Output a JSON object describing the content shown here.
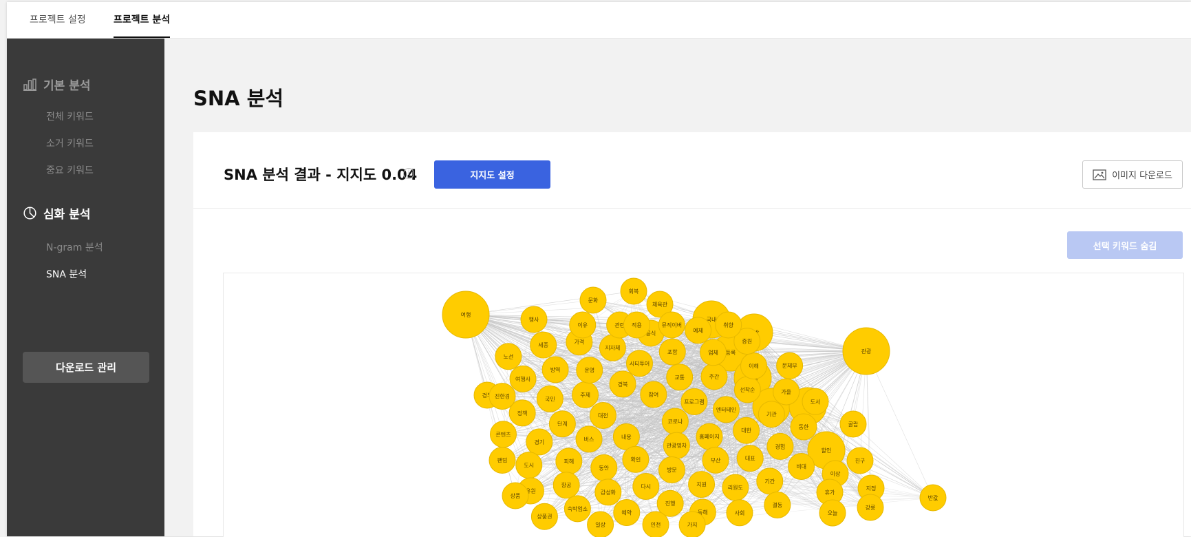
{
  "tabs": [
    {
      "label": "프로젝트 설정"
    },
    {
      "label": "프로젝트 분석"
    }
  ],
  "sidebar": {
    "basic": {
      "label": "기본 분석",
      "items": [
        {
          "label": "전체 키워드"
        },
        {
          "label": "소거 키워드"
        },
        {
          "label": "중요 키워드"
        }
      ]
    },
    "deep": {
      "label": "심화 분석",
      "items": [
        {
          "label": "N-gram 분석"
        },
        {
          "label": "SNA 분석"
        }
      ]
    },
    "download_label": "다운로드 관리"
  },
  "page_title": "SNA 분석",
  "panel": {
    "result_title": "SNA 분석 결과 - 지지도 0.04",
    "info_icon": "i",
    "support_button": "지지도 설정",
    "image_download": "이미지 다운로드",
    "hide_selected": "선택 키워드 숨김"
  },
  "colors": {
    "node": "#ffcc00",
    "node_stroke": "#e6b800",
    "edge": "#c4c4c4",
    "primary": "#3a63e0",
    "primary_disabled": "#b9c8f3",
    "sidebar": "#3a3a3a"
  },
  "network": {
    "nodes": [
      {
        "label": "여행",
        "size": "xl"
      },
      {
        "label": "관광",
        "size": "xl"
      },
      {
        "label": "국내",
        "size": "l"
      },
      {
        "label": "숙박",
        "size": "l"
      },
      {
        "label": "문화",
        "size": "m"
      },
      {
        "label": "회복",
        "size": "m"
      },
      {
        "label": "체육관",
        "size": "m"
      },
      {
        "label": "행사",
        "size": "m"
      },
      {
        "label": "코로나",
        "size": "m"
      },
      {
        "label": "내용",
        "size": "m"
      },
      {
        "label": "참여",
        "size": "m"
      },
      {
        "label": "관광명차",
        "size": "m"
      },
      {
        "label": "대전",
        "size": "m"
      },
      {
        "label": "프로그램",
        "size": "m"
      },
      {
        "label": "확인",
        "size": "m"
      },
      {
        "label": "경북",
        "size": "m"
      },
      {
        "label": "홈페이지",
        "size": "m"
      },
      {
        "label": "버스",
        "size": "m"
      },
      {
        "label": "등록",
        "size": "l"
      },
      {
        "label": "혜택",
        "size": "l"
      },
      {
        "label": "교통",
        "size": "m"
      },
      {
        "label": "방문",
        "size": "m"
      },
      {
        "label": "주제",
        "size": "m"
      },
      {
        "label": "엔터테인",
        "size": "m"
      },
      {
        "label": "동안",
        "size": "m"
      },
      {
        "label": "경부",
        "size": "m"
      },
      {
        "label": "시티투어",
        "size": "m"
      },
      {
        "label": "부산",
        "size": "m"
      },
      {
        "label": "단계",
        "size": "m"
      },
      {
        "label": "주간",
        "size": "m"
      },
      {
        "label": "다시",
        "size": "m"
      },
      {
        "label": "운영",
        "size": "m"
      },
      {
        "label": "대한",
        "size": "m"
      },
      {
        "label": "피해",
        "size": "m"
      },
      {
        "label": "포함",
        "size": "m"
      },
      {
        "label": "지원",
        "size": "m"
      },
      {
        "label": "지역",
        "size": "l"
      },
      {
        "label": "한국",
        "size": "l"
      },
      {
        "label": "국민",
        "size": "m"
      },
      {
        "label": "선착순",
        "size": "m"
      },
      {
        "label": "감성화",
        "size": "m"
      },
      {
        "label": "지자체",
        "size": "m"
      },
      {
        "label": "대표",
        "size": "m"
      },
      {
        "label": "경기",
        "size": "m"
      },
      {
        "label": "업체",
        "size": "m"
      },
      {
        "label": "골랍",
        "size": "m"
      },
      {
        "label": "진행",
        "size": "m"
      },
      {
        "label": "방역",
        "size": "m"
      },
      {
        "label": "기관",
        "size": "m"
      },
      {
        "label": "항공",
        "size": "m"
      },
      {
        "label": "공식",
        "size": "m"
      },
      {
        "label": "리원도",
        "size": "m"
      },
      {
        "label": "정책",
        "size": "m"
      },
      {
        "label": "이해",
        "size": "m"
      },
      {
        "label": "할인",
        "size": "l"
      },
      {
        "label": "예약",
        "size": "m"
      },
      {
        "label": "가격",
        "size": "m"
      },
      {
        "label": "경험",
        "size": "m"
      },
      {
        "label": "도시",
        "size": "m"
      },
      {
        "label": "예제",
        "size": "m"
      },
      {
        "label": "동해",
        "size": "m"
      },
      {
        "label": "여행사",
        "size": "m"
      },
      {
        "label": "친구",
        "size": "m"
      },
      {
        "label": "가을",
        "size": "m"
      },
      {
        "label": "숙박업소",
        "size": "m"
      },
      {
        "label": "관련",
        "size": "m"
      },
      {
        "label": "기간",
        "size": "m"
      },
      {
        "label": "콘텐츠",
        "size": "m"
      },
      {
        "label": "중원",
        "size": "m"
      },
      {
        "label": "인천",
        "size": "m"
      },
      {
        "label": "세종",
        "size": "m"
      },
      {
        "label": "이상",
        "size": "m"
      },
      {
        "label": "동한",
        "size": "m"
      },
      {
        "label": "유원",
        "size": "m"
      },
      {
        "label": "뮤직이버",
        "size": "m"
      },
      {
        "label": "사회",
        "size": "m"
      },
      {
        "label": "진한경",
        "size": "m"
      },
      {
        "label": "문체부",
        "size": "m"
      },
      {
        "label": "휴가",
        "size": "m"
      },
      {
        "label": "지정",
        "size": "m"
      },
      {
        "label": "상품",
        "size": "m"
      },
      {
        "label": "일상",
        "size": "m"
      },
      {
        "label": "이유",
        "size": "m"
      },
      {
        "label": "비대",
        "size": "m"
      },
      {
        "label": "팬덤",
        "size": "m"
      },
      {
        "label": "취향",
        "size": "m"
      },
      {
        "label": "가지",
        "size": "m"
      },
      {
        "label": "노선",
        "size": "m"
      },
      {
        "label": "도서",
        "size": "m"
      },
      {
        "label": "상품권",
        "size": "m"
      },
      {
        "label": "적용",
        "size": "m"
      },
      {
        "label": "결동",
        "size": "m"
      },
      {
        "label": "오늘",
        "size": "m"
      },
      {
        "label": "강릉",
        "size": "m"
      },
      {
        "label": "반값",
        "size": "m"
      }
    ]
  }
}
